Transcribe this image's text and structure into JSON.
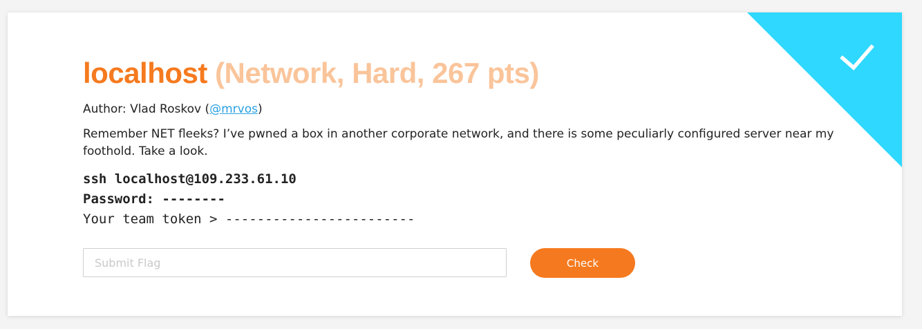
{
  "challenge": {
    "name": "localhost",
    "meta": "(Network, Hard, 267 pts)",
    "solved": true,
    "accent_color": "#f57a1f",
    "solved_color": "#2ed8ff"
  },
  "author": {
    "prefix": "Author: Vlad Roskov (",
    "handle": "@mrvos",
    "suffix": ")"
  },
  "description": "Remember NET fleeks? I’ve pwned a box in another corporate network, and there is some peculiarly configured server near my foothold. Take a look.",
  "connection": {
    "command": "ssh localhost@109.233.61.10",
    "password_line": "Password: --------",
    "token_line": "Your team token > ------------------------"
  },
  "flag_form": {
    "placeholder": "Submit Flag",
    "value": "",
    "button_label": "Check"
  },
  "icons": {
    "solved": "checkmark-icon"
  }
}
